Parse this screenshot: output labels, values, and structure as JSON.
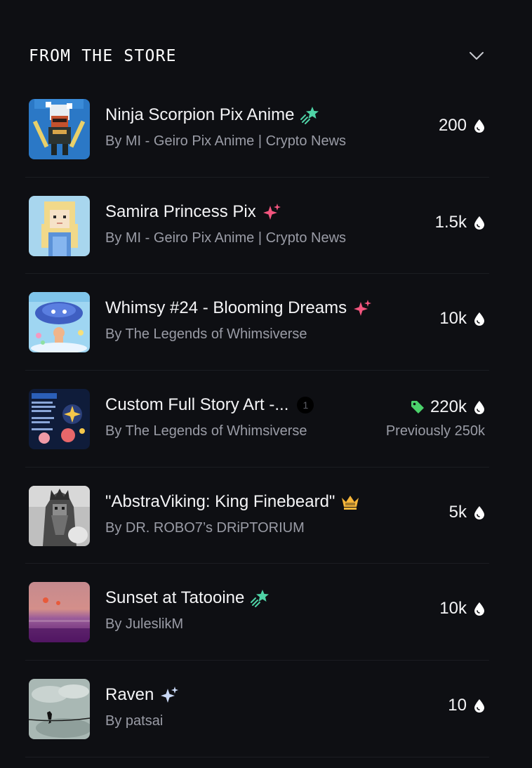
{
  "section": {
    "title": "FROM THE STORE"
  },
  "items": [
    {
      "title": "Ninja Scorpion Pix Anime",
      "subtitle": "By MI - Geiro Pix Anime | Crypto News",
      "price": "200",
      "badge": "shooting-star-icon",
      "badge_color": "#4fd3a6"
    },
    {
      "title": "Samira Princess Pix",
      "subtitle": "By MI - Geiro Pix Anime | Crypto News",
      "price": "1.5k",
      "badge": "sparkle-icon",
      "badge_color": "#f2557e"
    },
    {
      "title": "Whimsy #24 - Blooming Dreams",
      "subtitle": "By The Legends of Whimsiverse",
      "price": "10k",
      "badge": "sparkle-icon",
      "badge_color": "#f2557e"
    },
    {
      "title": "Custom Full Story Art -...",
      "subtitle": "By The Legends of Whimsiverse",
      "price": "220k",
      "previous": "Previously 250k",
      "count": "1",
      "tag_color": "#4bd26b"
    },
    {
      "title": "\"AbstraViking: King Finebeard\"",
      "subtitle": "By DR. ROBO7’s DRiPTORIUM",
      "price": "5k",
      "badge": "crown-icon",
      "badge_color": "#f5b53a"
    },
    {
      "title": "Sunset at Tatooine",
      "subtitle": "By JuleslikM",
      "price": "10k",
      "badge": "shooting-star-icon",
      "badge_color": "#4fd3a6"
    },
    {
      "title": "Raven",
      "subtitle": "By patsai",
      "price": "10",
      "badge": "sparkle-icon",
      "badge_color": "#c9d8f5"
    }
  ]
}
